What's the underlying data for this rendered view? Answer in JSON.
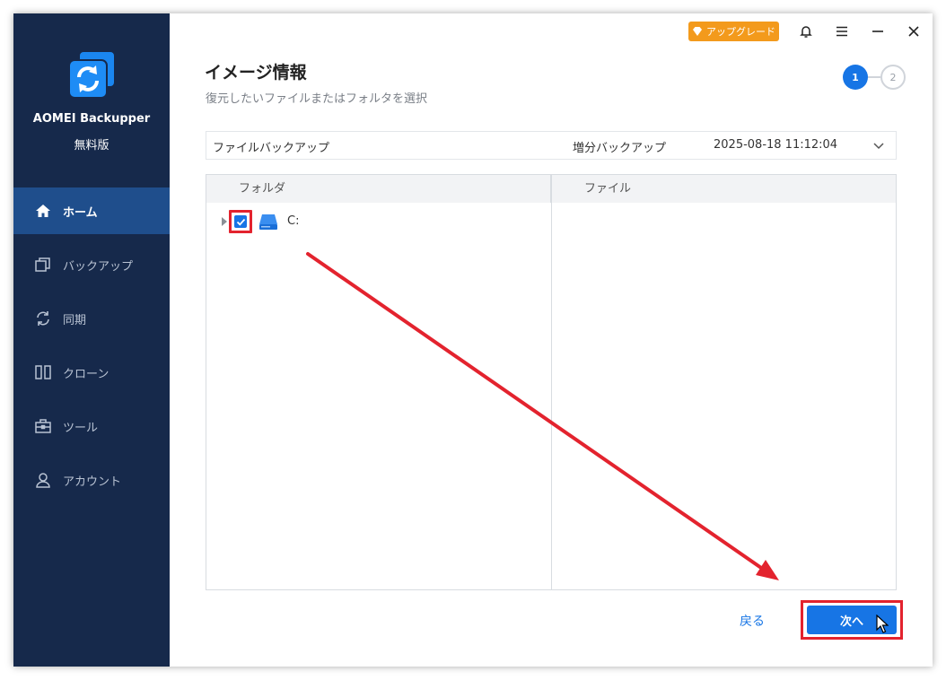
{
  "app": {
    "name": "AOMEI Backupper",
    "edition": "無料版"
  },
  "titlebar": {
    "upgrade_label": "アップグレード"
  },
  "sidebar": {
    "items": [
      {
        "label": "ホーム",
        "icon": "home-icon",
        "active": true
      },
      {
        "label": "バックアップ",
        "icon": "backup-icon",
        "active": false
      },
      {
        "label": "同期",
        "icon": "sync-icon",
        "active": false
      },
      {
        "label": "クローン",
        "icon": "clone-icon",
        "active": false
      },
      {
        "label": "ツール",
        "icon": "tools-icon",
        "active": false
      },
      {
        "label": "アカウント",
        "icon": "account-icon",
        "active": false
      }
    ]
  },
  "main": {
    "title": "イメージ情報",
    "subtitle": "復元したいファイルまたはフォルタを選択",
    "steps": {
      "current": "1",
      "next": "2"
    },
    "backup_select": {
      "name": "ファイルバックアップ",
      "type": "増分バックアップ",
      "time": "2025-08-18 11:12:04"
    },
    "tree": {
      "folder_header": "フォルダ",
      "file_header": "ファイル",
      "items": [
        {
          "label": "C:",
          "checked": true
        }
      ]
    },
    "footer": {
      "back_label": "戻る",
      "next_label": "次へ"
    }
  },
  "colors": {
    "sidebar_bg": "#16294b",
    "sidebar_active": "#1f4e8c",
    "accent": "#1775e5",
    "upgrade": "#f39a1c",
    "annotation": "#e3232e"
  }
}
